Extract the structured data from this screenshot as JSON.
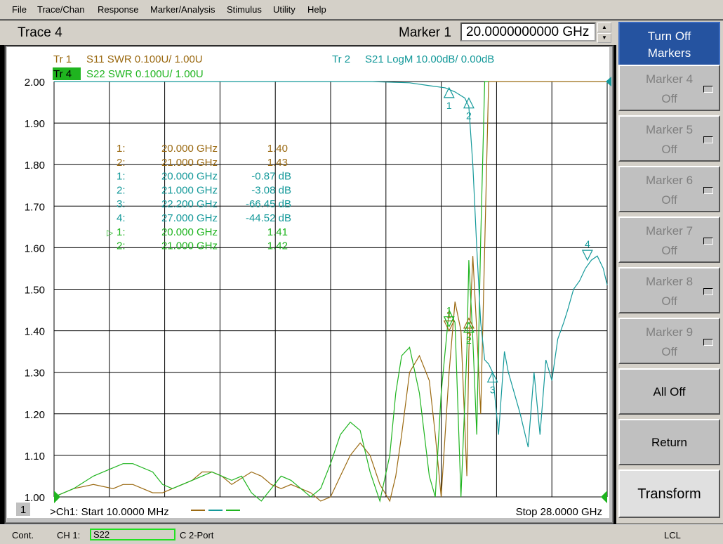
{
  "menu": [
    "File",
    "Trace/Chan",
    "Response",
    "Marker/Analysis",
    "Stimulus",
    "Utility",
    "Help"
  ],
  "toolbar": {
    "title": "Trace 4",
    "marker_label": "Marker 1",
    "marker_value": "20.0000000000 GHz",
    "spin_up": "▲",
    "spin_down": "▼"
  },
  "softkeys": [
    {
      "l1": "Turn Off",
      "l2": "Markers",
      "state": "active"
    },
    {
      "l1": "Marker 4",
      "l2": "Off",
      "state": "disabled"
    },
    {
      "l1": "Marker 5",
      "l2": "Off",
      "state": "disabled"
    },
    {
      "l1": "Marker 6",
      "l2": "Off",
      "state": "disabled"
    },
    {
      "l1": "Marker 7",
      "l2": "Off",
      "state": "disabled"
    },
    {
      "l1": "Marker 8",
      "l2": "Off",
      "state": "disabled"
    },
    {
      "l1": "Marker 9",
      "l2": "Off",
      "state": "disabled"
    },
    {
      "l1": "All Off",
      "l2": "",
      "state": "normal"
    },
    {
      "l1": "Return",
      "l2": "",
      "state": "normal"
    },
    {
      "l1": "Transform",
      "l2": "",
      "state": "light"
    }
  ],
  "status": {
    "mode": "Cont.",
    "channel": "CH 1:",
    "param": "S22",
    "cal": "C  2-Port",
    "remote": "LCL"
  },
  "colors": {
    "tr1": "#9b6a12",
    "tr2": "#14999a",
    "tr4": "#1fb41f",
    "grid": "#000000",
    "active_softkey": "#2553a0"
  },
  "chart_data": {
    "type": "line",
    "trace_headers": [
      {
        "id": "Tr 1",
        "text": "S11 SWR 0.100U/  1.00U",
        "color": "#9b6a12",
        "active": false
      },
      {
        "id": "Tr 4",
        "text": "S22 SWR 0.100U/  1.00U",
        "color": "#1fb41f",
        "active": true
      },
      {
        "id": "Tr 2",
        "text": "S21 LogM 10.00dB/  0.00dB",
        "color": "#14999a",
        "active": false
      }
    ],
    "x_start_label": ">Ch1: Start  10.0000 MHz",
    "x_stop_label": "Stop  28.0000 GHz",
    "channel_badge": "1",
    "xlim": [
      0.01,
      28
    ],
    "xunit": "GHz",
    "ylim": [
      1.0,
      2.0
    ],
    "y_ticks": [
      "2.00",
      "1.90",
      "1.80",
      "1.70",
      "1.60",
      "1.50",
      "1.40",
      "1.30",
      "1.20",
      "1.10",
      "1.00"
    ],
    "grid": true,
    "marker_table": [
      {
        "trace": "Tr 1",
        "n": "1:",
        "freq": "20.000 GHz",
        "value": "1.40",
        "active": false
      },
      {
        "trace": "Tr 1",
        "n": "2:",
        "freq": "21.000 GHz",
        "value": "1.43",
        "active": false
      },
      {
        "trace": "Tr 2",
        "n": "1:",
        "freq": "20.000 GHz",
        "value": "-0.87 dB",
        "active": false
      },
      {
        "trace": "Tr 2",
        "n": "2:",
        "freq": "21.000 GHz",
        "value": "-3.08 dB",
        "active": false
      },
      {
        "trace": "Tr 2",
        "n": "3:",
        "freq": "22.200 GHz",
        "value": "-66.45 dB",
        "active": false
      },
      {
        "trace": "Tr 2",
        "n": "4:",
        "freq": "27.000 GHz",
        "value": "-44.52 dB",
        "active": false
      },
      {
        "trace": "Tr 4",
        "n": "1:",
        "freq": "20.000 GHz",
        "value": "1.41",
        "active": true
      },
      {
        "trace": "Tr 4",
        "n": "2:",
        "freq": "21.000 GHz",
        "value": "1.42",
        "active": false
      }
    ],
    "series": [
      {
        "name": "Tr 1 S11 SWR",
        "color": "#9b6a12",
        "x": [
          0.01,
          1,
          2,
          3,
          3.5,
          4,
          5,
          5.5,
          6,
          7,
          7.5,
          8,
          8.5,
          9,
          10,
          10.5,
          11,
          11.5,
          12,
          12.5,
          13,
          13.5,
          14,
          14.5,
          15,
          15.5,
          16,
          16.5,
          17,
          17.3,
          17.6,
          18,
          18.5,
          19,
          19.3,
          19.6,
          20,
          20.3,
          20.6,
          20.9,
          21,
          21.2,
          21.4,
          21.6,
          21.8,
          22,
          28
        ],
        "y": [
          1.0,
          1.02,
          1.03,
          1.02,
          1.03,
          1.03,
          1.01,
          1.01,
          1.02,
          1.04,
          1.06,
          1.06,
          1.05,
          1.03,
          1.06,
          1.05,
          1.03,
          1.02,
          1.03,
          1.02,
          1.01,
          0.99,
          1.0,
          1.05,
          1.1,
          1.13,
          1.1,
          1.03,
          0.99,
          1.05,
          1.15,
          1.3,
          1.34,
          1.28,
          1.15,
          1.0,
          1.3,
          1.47,
          1.4,
          1.05,
          1.35,
          1.58,
          1.4,
          1.2,
          1.6,
          2.0,
          2.0
        ]
      },
      {
        "name": "Tr 4 S22 SWR",
        "color": "#1fb41f",
        "x": [
          0.01,
          1,
          2,
          3,
          3.5,
          4,
          5,
          5.5,
          6,
          7,
          7.5,
          8,
          8.5,
          9,
          9.5,
          10,
          10.5,
          11,
          11.5,
          12,
          12.5,
          13,
          13.5,
          14,
          14.5,
          15,
          15.5,
          16,
          16.5,
          17,
          17.3,
          17.6,
          18,
          18.5,
          19,
          19.3,
          19.6,
          20,
          20.3,
          20.6,
          20.9,
          21,
          21.2,
          21.4,
          21.6,
          21.8,
          22,
          28
        ],
        "y": [
          1.0,
          1.02,
          1.05,
          1.07,
          1.08,
          1.08,
          1.06,
          1.03,
          1.02,
          1.04,
          1.05,
          1.06,
          1.05,
          1.04,
          1.05,
          1.01,
          0.99,
          1.02,
          1.05,
          1.04,
          1.02,
          1.0,
          1.02,
          1.08,
          1.15,
          1.18,
          1.16,
          1.06,
          0.99,
          1.1,
          1.25,
          1.34,
          1.36,
          1.25,
          1.05,
          1.0,
          1.25,
          1.45,
          1.42,
          1.0,
          1.35,
          1.57,
          1.38,
          1.15,
          1.62,
          2.0,
          2.0
        ]
      },
      {
        "name": "Tr 2 S21 LogM (scaled)",
        "color": "#14999a",
        "x": [
          0.01,
          2,
          4,
          6,
          8,
          10,
          12,
          14,
          16,
          18,
          19,
          19.8,
          20.3,
          20.8,
          21.0,
          21.2,
          21.4,
          21.6,
          21.8,
          22.0,
          22.2,
          22.5,
          22.8,
          23.0,
          23.3,
          23.6,
          24.0,
          24.3,
          24.6,
          24.9,
          25.2,
          25.5,
          25.8,
          26.0,
          26.3,
          26.6,
          26.9,
          27.2,
          27.5,
          27.8,
          28
        ],
        "y": [
          2.0,
          2.0,
          2.0,
          2.0,
          2.0,
          2.0,
          2.0,
          2.0,
          2.0,
          1.997,
          1.99,
          1.985,
          1.975,
          1.96,
          1.94,
          1.8,
          1.6,
          1.42,
          1.33,
          1.32,
          1.3,
          1.15,
          1.35,
          1.3,
          1.25,
          1.2,
          1.12,
          1.3,
          1.15,
          1.33,
          1.28,
          1.38,
          1.42,
          1.45,
          1.5,
          1.52,
          1.55,
          1.57,
          1.58,
          1.55,
          1.51
        ]
      }
    ],
    "markers": [
      {
        "trace": "Tr 2",
        "label": "1",
        "x": 20.0,
        "y": 1.985,
        "dir": "up",
        "color": "#14999a"
      },
      {
        "trace": "Tr 2",
        "label": "2",
        "x": 21.0,
        "y": 1.96,
        "dir": "up",
        "color": "#14999a"
      },
      {
        "trace": "Tr 2",
        "label": "3",
        "x": 22.2,
        "y": 1.3,
        "dir": "up",
        "color": "#14999a"
      },
      {
        "trace": "Tr 2",
        "label": "4",
        "x": 27.0,
        "y": 1.57,
        "dir": "down",
        "color": "#14999a"
      },
      {
        "trace": "Tr 1",
        "label": "1",
        "x": 20.0,
        "y": 1.4,
        "dir": "down",
        "color": "#9b6a12"
      },
      {
        "trace": "Tr 1",
        "label": "2",
        "x": 21.0,
        "y": 1.43,
        "dir": "up",
        "color": "#9b6a12"
      },
      {
        "trace": "Tr 4",
        "label": "1",
        "x": 20.0,
        "y": 1.41,
        "dir": "down",
        "color": "#1fb41f"
      },
      {
        "trace": "Tr 4",
        "label": "2",
        "x": 21.0,
        "y": 1.42,
        "dir": "up",
        "color": "#1fb41f"
      }
    ]
  }
}
